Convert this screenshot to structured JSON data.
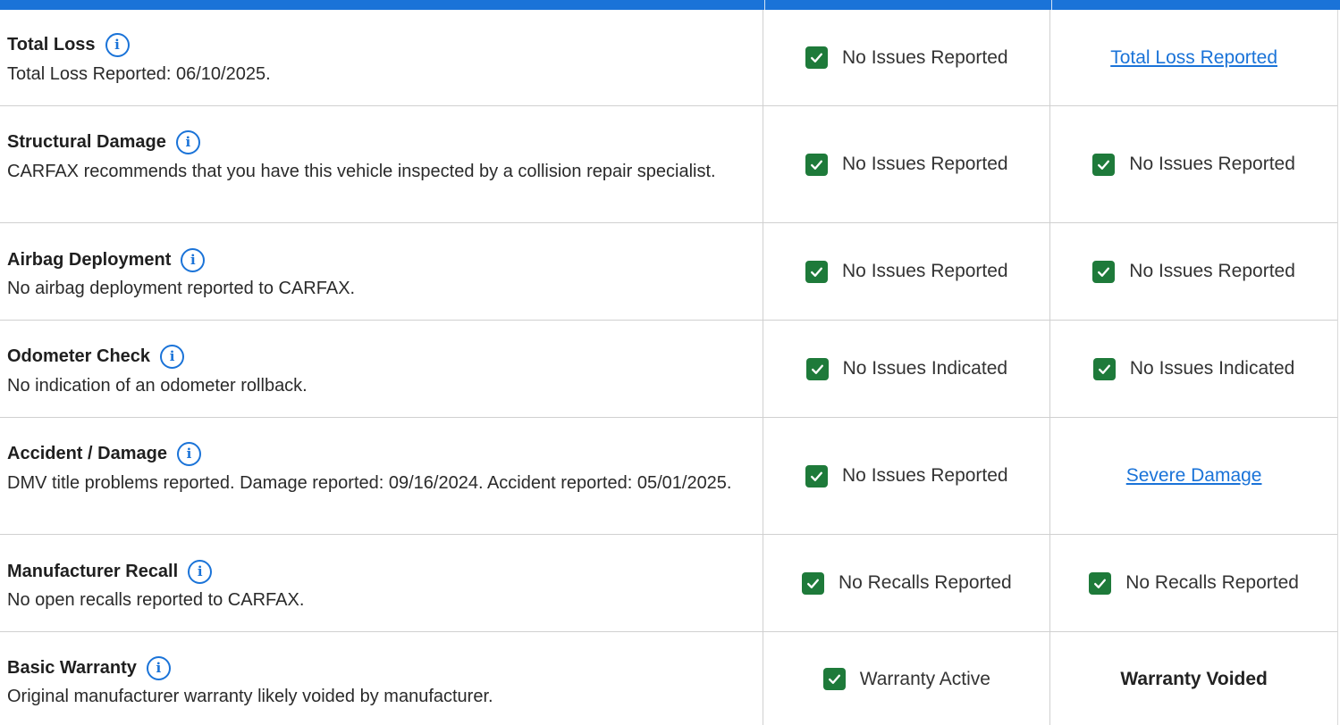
{
  "rows": [
    {
      "title": "Total Loss",
      "description": "Total Loss Reported: 06/10/2025.",
      "col1": {
        "type": "check",
        "text": "No Issues Reported"
      },
      "col2": {
        "type": "link",
        "text": "Total Loss Reported"
      }
    },
    {
      "title": "Structural Damage",
      "description": "CARFAX recommends that you have this vehicle inspected by a collision repair specialist.",
      "col1": {
        "type": "check",
        "text": "No Issues Reported"
      },
      "col2": {
        "type": "check",
        "text": "No Issues Reported"
      }
    },
    {
      "title": "Airbag Deployment",
      "description": "No airbag deployment reported to CARFAX.",
      "col1": {
        "type": "check",
        "text": "No Issues Reported"
      },
      "col2": {
        "type": "check",
        "text": "No Issues Reported"
      }
    },
    {
      "title": "Odometer Check",
      "description": "No indication of an odometer rollback.",
      "col1": {
        "type": "check",
        "text": "No Issues Indicated"
      },
      "col2": {
        "type": "check",
        "text": "No Issues Indicated"
      }
    },
    {
      "title": "Accident / Damage",
      "description": "DMV title problems reported. Damage reported: 09/16/2024. Accident reported: 05/01/2025.",
      "col1": {
        "type": "check",
        "text": "No Issues Reported"
      },
      "col2": {
        "type": "link",
        "text": "Severe Damage"
      }
    },
    {
      "title": "Manufacturer Recall",
      "description": "No open recalls reported to CARFAX.",
      "col1": {
        "type": "check",
        "text": "No Recalls Reported"
      },
      "col2": {
        "type": "check",
        "text": "No Recalls Reported"
      }
    },
    {
      "title": "Basic Warranty",
      "description": "Original manufacturer warranty likely voided by manufacturer.",
      "col1": {
        "type": "check",
        "text": "Warranty Active"
      },
      "col2": {
        "type": "bold",
        "text": "Warranty Voided"
      }
    }
  ],
  "info_icon": "info-circle-icon",
  "check_icon": "checkbox-checked-icon",
  "colors": {
    "header": "#1a73d8",
    "check": "#1e7a3a",
    "link": "#1a73d8"
  }
}
